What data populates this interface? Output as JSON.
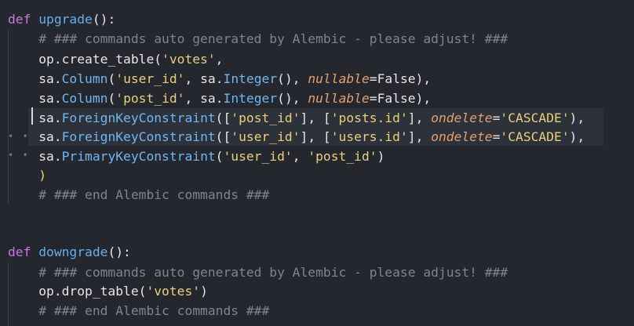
{
  "code": {
    "lines": [
      {
        "name": "def-upgrade",
        "parts": [
          [
            "kw",
            "def "
          ],
          [
            "fn",
            "upgrade"
          ],
          [
            "txt",
            "():"
          ]
        ]
      },
      {
        "name": "comment-1",
        "parts": [
          [
            "cm",
            "    # ### commands auto generated by Alembic - please adjust! ###"
          ]
        ]
      },
      {
        "name": "create-table",
        "parts": [
          [
            "txt",
            "    op.create_table("
          ],
          [
            "str",
            "'votes'"
          ],
          [
            "txt",
            ","
          ]
        ]
      },
      {
        "name": "column-user",
        "parts": [
          [
            "txt",
            "    sa."
          ],
          [
            "cls",
            "Column"
          ],
          [
            "txt",
            "("
          ],
          [
            "str",
            "'user_id'"
          ],
          [
            "txt",
            ", sa."
          ],
          [
            "cls",
            "Integer"
          ],
          [
            "txt",
            "(), "
          ],
          [
            "attr",
            "nullable"
          ],
          [
            "txt",
            "="
          ],
          [
            "const",
            "False"
          ],
          [
            "txt",
            "),"
          ]
        ]
      },
      {
        "name": "column-post",
        "parts": [
          [
            "txt",
            "    sa."
          ],
          [
            "cls",
            "Column"
          ],
          [
            "txt",
            "("
          ],
          [
            "str",
            "'post_id'"
          ],
          [
            "txt",
            ", sa."
          ],
          [
            "cls",
            "Integer"
          ],
          [
            "txt",
            "(), "
          ],
          [
            "attr",
            "nullable"
          ],
          [
            "txt",
            "="
          ],
          [
            "const",
            "False"
          ],
          [
            "txt",
            "),"
          ]
        ]
      },
      {
        "name": "fk-post",
        "parts": [
          [
            "txt",
            "    sa."
          ],
          [
            "cls",
            "ForeignKeyConstraint"
          ],
          [
            "txt",
            "(["
          ],
          [
            "str",
            "'post_id'"
          ],
          [
            "txt",
            "], ["
          ],
          [
            "str",
            "'posts.id'"
          ],
          [
            "txt",
            "], "
          ],
          [
            "attr",
            "ondelete"
          ],
          [
            "txt",
            "="
          ],
          [
            "str",
            "'CASCADE'"
          ],
          [
            "txt",
            "),"
          ]
        ]
      },
      {
        "name": "fk-user",
        "parts": [
          [
            "txt",
            "    sa."
          ],
          [
            "cls",
            "ForeignKeyConstraint"
          ],
          [
            "txt",
            "(["
          ],
          [
            "str",
            "'user_id'"
          ],
          [
            "txt",
            "], ["
          ],
          [
            "str",
            "'users.id'"
          ],
          [
            "txt",
            "], "
          ],
          [
            "attr",
            "ondelete"
          ],
          [
            "txt",
            "="
          ],
          [
            "str",
            "'CASCADE'"
          ],
          [
            "txt",
            "),"
          ]
        ]
      },
      {
        "name": "pk",
        "parts": [
          [
            "txt",
            "    sa."
          ],
          [
            "cls",
            "PrimaryKeyConstraint"
          ],
          [
            "txt",
            "("
          ],
          [
            "str",
            "'user_id'"
          ],
          [
            "txt",
            ", "
          ],
          [
            "str",
            "'post_id'"
          ],
          [
            "txt",
            ")"
          ]
        ]
      },
      {
        "name": "close-paren",
        "parts": [
          [
            "str",
            "    )"
          ]
        ]
      },
      {
        "name": "comment-2",
        "parts": [
          [
            "cm",
            "    # ### end Alembic commands ###"
          ]
        ]
      },
      {
        "name": "blank-1",
        "parts": [
          [
            "txt",
            ""
          ]
        ]
      },
      {
        "name": "blank-2",
        "parts": [
          [
            "txt",
            ""
          ]
        ]
      },
      {
        "name": "def-downgrade",
        "parts": [
          [
            "kw",
            "def "
          ],
          [
            "fn",
            "downgrade"
          ],
          [
            "txt",
            "():"
          ]
        ]
      },
      {
        "name": "comment-3",
        "parts": [
          [
            "cm",
            "    # ### commands auto generated by Alembic - please adjust! ###"
          ]
        ]
      },
      {
        "name": "drop-table",
        "parts": [
          [
            "txt",
            "    op.drop_table("
          ],
          [
            "str",
            "'votes'"
          ],
          [
            "txt",
            ")"
          ]
        ]
      },
      {
        "name": "comment-4",
        "parts": [
          [
            "cm",
            "    # ### end Alembic commands ###"
          ]
        ]
      }
    ]
  },
  "colors": {
    "background": "#24272e",
    "keyword": "#c678dd",
    "function": "#61afef",
    "string": "#e8d07a",
    "comment": "#7f848e",
    "parameter": "#e5a06b",
    "selection": "#2d313a"
  },
  "gutter_marker": "• • • •"
}
